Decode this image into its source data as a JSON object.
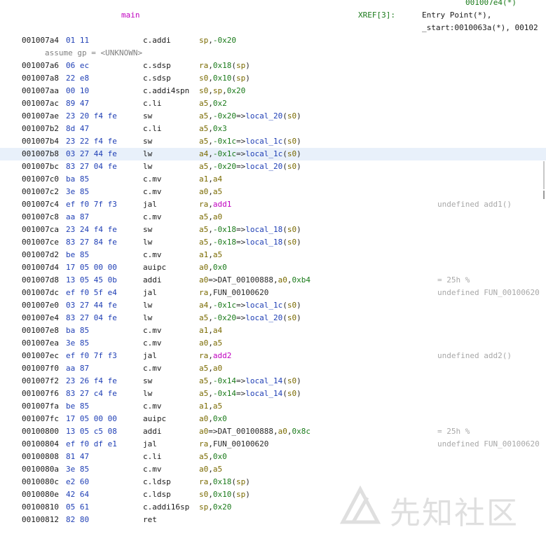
{
  "header": {
    "top_xref": "001007e4(*)",
    "function_name": "main",
    "xref_label": "XREF[3]:",
    "xref_line1": "Entry Point(*),",
    "xref_line2": "_start:0010063a(*), 00102"
  },
  "assume_line": "assume gp = <UNKNOWN>",
  "selected_address": "001007b8",
  "rows": [
    {
      "addr": "001007a4",
      "bytes": "01 11",
      "mnem": "c.addi",
      "ops": [
        [
          "reg",
          "sp"
        ],
        [
          "txt",
          ","
        ],
        [
          "num",
          "-0x20"
        ]
      ]
    },
    {
      "addr": "001007a6",
      "bytes": "06 ec",
      "mnem": "c.sdsp",
      "ops": [
        [
          "reg",
          "ra"
        ],
        [
          "txt",
          ","
        ],
        [
          "num",
          "0x18"
        ],
        [
          "txt",
          "("
        ],
        [
          "reg",
          "sp"
        ],
        [
          "txt",
          ")"
        ]
      ]
    },
    {
      "addr": "001007a8",
      "bytes": "22 e8",
      "mnem": "c.sdsp",
      "ops": [
        [
          "reg",
          "s0"
        ],
        [
          "txt",
          ","
        ],
        [
          "num",
          "0x10"
        ],
        [
          "txt",
          "("
        ],
        [
          "reg",
          "sp"
        ],
        [
          "txt",
          ")"
        ]
      ]
    },
    {
      "addr": "001007aa",
      "bytes": "00 10",
      "mnem": "c.addi4spn",
      "ops": [
        [
          "reg",
          "s0"
        ],
        [
          "txt",
          ","
        ],
        [
          "reg",
          "sp"
        ],
        [
          "txt",
          ","
        ],
        [
          "num",
          "0x20"
        ]
      ]
    },
    {
      "addr": "001007ac",
      "bytes": "89 47",
      "mnem": "c.li",
      "ops": [
        [
          "reg",
          "a5"
        ],
        [
          "txt",
          ","
        ],
        [
          "num",
          "0x2"
        ]
      ]
    },
    {
      "addr": "001007ae",
      "bytes": "23 20 f4 fe",
      "mnem": "sw",
      "ops": [
        [
          "reg",
          "a5"
        ],
        [
          "txt",
          ","
        ],
        [
          "num",
          "-0x20"
        ],
        [
          "txt",
          "=>"
        ],
        [
          "lbl",
          "local_20"
        ],
        [
          "txt",
          "("
        ],
        [
          "reg",
          "s0"
        ],
        [
          "txt",
          ")"
        ]
      ]
    },
    {
      "addr": "001007b2",
      "bytes": "8d 47",
      "mnem": "c.li",
      "ops": [
        [
          "reg",
          "a5"
        ],
        [
          "txt",
          ","
        ],
        [
          "num",
          "0x3"
        ]
      ]
    },
    {
      "addr": "001007b4",
      "bytes": "23 22 f4 fe",
      "mnem": "sw",
      "ops": [
        [
          "reg",
          "a5"
        ],
        [
          "txt",
          ","
        ],
        [
          "num",
          "-0x1c"
        ],
        [
          "txt",
          "=>"
        ],
        [
          "lbl",
          "local_1c"
        ],
        [
          "txt",
          "("
        ],
        [
          "reg",
          "s0"
        ],
        [
          "txt",
          ")"
        ]
      ]
    },
    {
      "addr": "001007b8",
      "bytes": "03 27 44 fe",
      "mnem": "lw",
      "ops": [
        [
          "reg",
          "a4"
        ],
        [
          "txt",
          ","
        ],
        [
          "num",
          "-0x1c"
        ],
        [
          "txt",
          "=>"
        ],
        [
          "lbl",
          "local_1c"
        ],
        [
          "txt",
          "("
        ],
        [
          "reg",
          "s0"
        ],
        [
          "txt",
          ")"
        ]
      ]
    },
    {
      "addr": "001007bc",
      "bytes": "83 27 04 fe",
      "mnem": "lw",
      "ops": [
        [
          "reg",
          "a5"
        ],
        [
          "txt",
          ","
        ],
        [
          "num",
          "-0x20"
        ],
        [
          "txt",
          "=>"
        ],
        [
          "lbl",
          "local_20"
        ],
        [
          "txt",
          "("
        ],
        [
          "reg",
          "s0"
        ],
        [
          "txt",
          ")"
        ]
      ]
    },
    {
      "addr": "001007c0",
      "bytes": "ba 85",
      "mnem": "c.mv",
      "ops": [
        [
          "reg",
          "a1"
        ],
        [
          "txt",
          ","
        ],
        [
          "reg",
          "a4"
        ]
      ]
    },
    {
      "addr": "001007c2",
      "bytes": "3e 85",
      "mnem": "c.mv",
      "ops": [
        [
          "reg",
          "a0"
        ],
        [
          "txt",
          ","
        ],
        [
          "reg",
          "a5"
        ]
      ]
    },
    {
      "addr": "001007c4",
      "bytes": "ef f0 7f f3",
      "mnem": "jal",
      "ops": [
        [
          "reg",
          "ra"
        ],
        [
          "txt",
          ","
        ],
        [
          "fn",
          "add1"
        ]
      ],
      "comment": "undefined add1()"
    },
    {
      "addr": "001007c8",
      "bytes": "aa 87",
      "mnem": "c.mv",
      "ops": [
        [
          "reg",
          "a5"
        ],
        [
          "txt",
          ","
        ],
        [
          "reg",
          "a0"
        ]
      ]
    },
    {
      "addr": "001007ca",
      "bytes": "23 24 f4 fe",
      "mnem": "sw",
      "ops": [
        [
          "reg",
          "a5"
        ],
        [
          "txt",
          ","
        ],
        [
          "num",
          "-0x18"
        ],
        [
          "txt",
          "=>"
        ],
        [
          "lbl",
          "local_18"
        ],
        [
          "txt",
          "("
        ],
        [
          "reg",
          "s0"
        ],
        [
          "txt",
          ")"
        ]
      ]
    },
    {
      "addr": "001007ce",
      "bytes": "83 27 84 fe",
      "mnem": "lw",
      "ops": [
        [
          "reg",
          "a5"
        ],
        [
          "txt",
          ","
        ],
        [
          "num",
          "-0x18"
        ],
        [
          "txt",
          "=>"
        ],
        [
          "lbl",
          "local_18"
        ],
        [
          "txt",
          "("
        ],
        [
          "reg",
          "s0"
        ],
        [
          "txt",
          ")"
        ]
      ]
    },
    {
      "addr": "001007d2",
      "bytes": "be 85",
      "mnem": "c.mv",
      "ops": [
        [
          "reg",
          "a1"
        ],
        [
          "txt",
          ","
        ],
        [
          "reg",
          "a5"
        ]
      ]
    },
    {
      "addr": "001007d4",
      "bytes": "17 05 00 00",
      "mnem": "auipc",
      "ops": [
        [
          "reg",
          "a0"
        ],
        [
          "txt",
          ","
        ],
        [
          "num",
          "0x0"
        ]
      ]
    },
    {
      "addr": "001007d8",
      "bytes": "13 05 45 0b",
      "mnem": "addi",
      "ops": [
        [
          "reg",
          "a0"
        ],
        [
          "txt",
          "=>DAT_00100888,"
        ],
        [
          "reg",
          "a0"
        ],
        [
          "txt",
          ","
        ],
        [
          "num",
          "0xb4"
        ]
      ],
      "comment": "= 25h    %"
    },
    {
      "addr": "001007dc",
      "bytes": "ef f0 5f e4",
      "mnem": "jal",
      "ops": [
        [
          "reg",
          "ra"
        ],
        [
          "txt",
          ","
        ],
        [
          "txt",
          "FUN_00100620"
        ]
      ],
      "comment": "undefined FUN_00100620"
    },
    {
      "addr": "001007e0",
      "bytes": "03 27 44 fe",
      "mnem": "lw",
      "ops": [
        [
          "reg",
          "a4"
        ],
        [
          "txt",
          ","
        ],
        [
          "num",
          "-0x1c"
        ],
        [
          "txt",
          "=>"
        ],
        [
          "lbl",
          "local_1c"
        ],
        [
          "txt",
          "("
        ],
        [
          "reg",
          "s0"
        ],
        [
          "txt",
          ")"
        ]
      ]
    },
    {
      "addr": "001007e4",
      "bytes": "83 27 04 fe",
      "mnem": "lw",
      "ops": [
        [
          "reg",
          "a5"
        ],
        [
          "txt",
          ","
        ],
        [
          "num",
          "-0x20"
        ],
        [
          "txt",
          "=>"
        ],
        [
          "lbl",
          "local_20"
        ],
        [
          "txt",
          "("
        ],
        [
          "reg",
          "s0"
        ],
        [
          "txt",
          ")"
        ]
      ]
    },
    {
      "addr": "001007e8",
      "bytes": "ba 85",
      "mnem": "c.mv",
      "ops": [
        [
          "reg",
          "a1"
        ],
        [
          "txt",
          ","
        ],
        [
          "reg",
          "a4"
        ]
      ]
    },
    {
      "addr": "001007ea",
      "bytes": "3e 85",
      "mnem": "c.mv",
      "ops": [
        [
          "reg",
          "a0"
        ],
        [
          "txt",
          ","
        ],
        [
          "reg",
          "a5"
        ]
      ]
    },
    {
      "addr": "001007ec",
      "bytes": "ef f0 7f f3",
      "mnem": "jal",
      "ops": [
        [
          "reg",
          "ra"
        ],
        [
          "txt",
          ","
        ],
        [
          "fn",
          "add2"
        ]
      ],
      "comment": "undefined add2()"
    },
    {
      "addr": "001007f0",
      "bytes": "aa 87",
      "mnem": "c.mv",
      "ops": [
        [
          "reg",
          "a5"
        ],
        [
          "txt",
          ","
        ],
        [
          "reg",
          "a0"
        ]
      ]
    },
    {
      "addr": "001007f2",
      "bytes": "23 26 f4 fe",
      "mnem": "sw",
      "ops": [
        [
          "reg",
          "a5"
        ],
        [
          "txt",
          ","
        ],
        [
          "num",
          "-0x14"
        ],
        [
          "txt",
          "=>"
        ],
        [
          "lbl",
          "local_14"
        ],
        [
          "txt",
          "("
        ],
        [
          "reg",
          "s0"
        ],
        [
          "txt",
          ")"
        ]
      ]
    },
    {
      "addr": "001007f6",
      "bytes": "83 27 c4 fe",
      "mnem": "lw",
      "ops": [
        [
          "reg",
          "a5"
        ],
        [
          "txt",
          ","
        ],
        [
          "num",
          "-0x14"
        ],
        [
          "txt",
          "=>"
        ],
        [
          "lbl",
          "local_14"
        ],
        [
          "txt",
          "("
        ],
        [
          "reg",
          "s0"
        ],
        [
          "txt",
          ")"
        ]
      ]
    },
    {
      "addr": "001007fa",
      "bytes": "be 85",
      "mnem": "c.mv",
      "ops": [
        [
          "reg",
          "a1"
        ],
        [
          "txt",
          ","
        ],
        [
          "reg",
          "a5"
        ]
      ]
    },
    {
      "addr": "001007fc",
      "bytes": "17 05 00 00",
      "mnem": "auipc",
      "ops": [
        [
          "reg",
          "a0"
        ],
        [
          "txt",
          ","
        ],
        [
          "num",
          "0x0"
        ]
      ]
    },
    {
      "addr": "00100800",
      "bytes": "13 05 c5 08",
      "mnem": "addi",
      "ops": [
        [
          "reg",
          "a0"
        ],
        [
          "txt",
          "=>DAT_00100888,"
        ],
        [
          "reg",
          "a0"
        ],
        [
          "txt",
          ","
        ],
        [
          "num",
          "0x8c"
        ]
      ],
      "comment": "= 25h    %"
    },
    {
      "addr": "00100804",
      "bytes": "ef f0 df e1",
      "mnem": "jal",
      "ops": [
        [
          "reg",
          "ra"
        ],
        [
          "txt",
          ","
        ],
        [
          "txt",
          "FUN_00100620"
        ]
      ],
      "comment": "undefined FUN_00100620"
    },
    {
      "addr": "00100808",
      "bytes": "81 47",
      "mnem": "c.li",
      "ops": [
        [
          "reg",
          "a5"
        ],
        [
          "txt",
          ","
        ],
        [
          "num",
          "0x0"
        ]
      ]
    },
    {
      "addr": "0010080a",
      "bytes": "3e 85",
      "mnem": "c.mv",
      "ops": [
        [
          "reg",
          "a0"
        ],
        [
          "txt",
          ","
        ],
        [
          "reg",
          "a5"
        ]
      ]
    },
    {
      "addr": "0010080c",
      "bytes": "e2 60",
      "mnem": "c.ldsp",
      "ops": [
        [
          "reg",
          "ra"
        ],
        [
          "txt",
          ","
        ],
        [
          "num",
          "0x18"
        ],
        [
          "txt",
          "("
        ],
        [
          "reg",
          "sp"
        ],
        [
          "txt",
          ")"
        ]
      ]
    },
    {
      "addr": "0010080e",
      "bytes": "42 64",
      "mnem": "c.ldsp",
      "ops": [
        [
          "reg",
          "s0"
        ],
        [
          "txt",
          ","
        ],
        [
          "num",
          "0x10"
        ],
        [
          "txt",
          "("
        ],
        [
          "reg",
          "sp"
        ],
        [
          "txt",
          ")"
        ]
      ]
    },
    {
      "addr": "00100810",
      "bytes": "05 61",
      "mnem": "c.addi16sp",
      "ops": [
        [
          "reg",
          "sp"
        ],
        [
          "txt",
          ","
        ],
        [
          "num",
          "0x20"
        ]
      ]
    },
    {
      "addr": "00100812",
      "bytes": "82 80",
      "mnem": "ret",
      "ops": []
    }
  ],
  "watermark": {
    "text": "先知社区"
  }
}
